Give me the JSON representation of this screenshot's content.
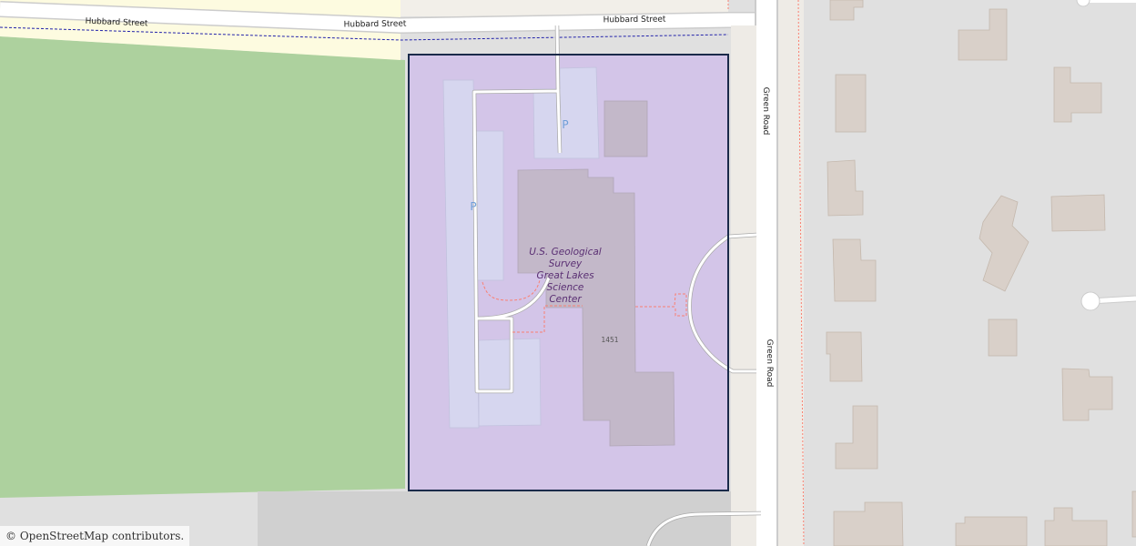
{
  "map": {
    "streets": {
      "hubbard": "Hubbard Street",
      "green": "Green Road"
    },
    "poi": {
      "name_lines": [
        "U.S. Geological",
        "Survey",
        "Great Lakes",
        "Science",
        "Center"
      ],
      "address": "1451"
    },
    "parking_symbol": "P",
    "colors": {
      "background": "#e0e0e0",
      "forest": "#add19e",
      "government_area": "#d3c5e8",
      "building": "#c3b8c9",
      "residential_building": "#d9d0c9",
      "parking": "#d6d6ef",
      "road": "#ffffff",
      "road_casing": "#cccccc",
      "road_band": "#fdfbe0",
      "selection_outline": "#1a2a4a",
      "footpath": "#fa8072",
      "boundary": "#2222aa"
    }
  },
  "attribution": {
    "symbol": "©",
    "link": "OpenStreetMap",
    "text": "contributors."
  }
}
